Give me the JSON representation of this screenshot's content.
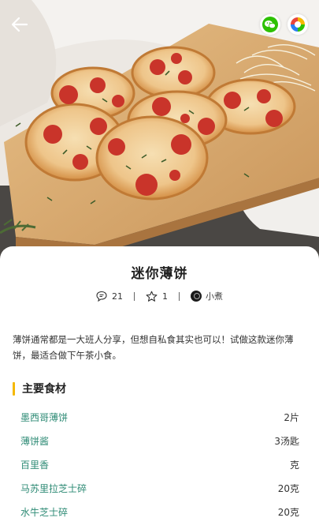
{
  "header": {
    "back_icon": "back-arrow-icon",
    "share_buttons": [
      {
        "name": "wechat",
        "icon": "wechat-icon",
        "color": "#2dc100"
      },
      {
        "name": "moments",
        "icon": "moments-icon",
        "color": "#f5b800"
      }
    ]
  },
  "recipe": {
    "title": "迷你薄饼",
    "comments": "21",
    "favorites": "1",
    "author": "小煮",
    "description": "薄饼通常都是一大班人分享，但想自私食其实也可以！试做这款迷你薄饼，最适合做下午茶小食。"
  },
  "ingredients_section": {
    "title": "主要食材",
    "accent_color": "#f5b800",
    "items": [
      {
        "name": "墨西哥薄饼",
        "qty": "2片"
      },
      {
        "name": "薄饼酱",
        "qty": "3汤匙"
      },
      {
        "name": "百里香",
        "qty": "克"
      },
      {
        "name": "马苏里拉芝士碎",
        "qty": "20克"
      },
      {
        "name": "水牛芝士碎",
        "qty": "20克"
      }
    ]
  }
}
